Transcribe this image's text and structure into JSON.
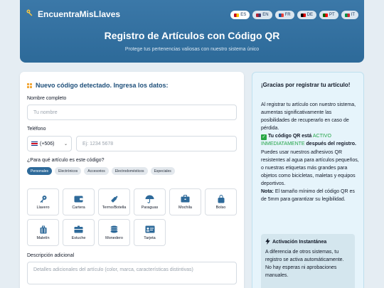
{
  "brand": {
    "name": "EncuentraMisLlaves",
    "icon": "key-icon"
  },
  "languages": [
    {
      "code": "ES",
      "flag_colors": [
        "#c60b1e",
        "#ffc400"
      ],
      "active": true
    },
    {
      "code": "EN",
      "flag_colors": [
        "#b22234",
        "#3c3b6e"
      ],
      "active": false
    },
    {
      "code": "FR",
      "flag_colors": [
        "#0055a4",
        "#ef4135"
      ],
      "active": false
    },
    {
      "code": "DE",
      "flag_colors": [
        "#000000",
        "#dd0000"
      ],
      "active": false
    },
    {
      "code": "PT",
      "flag_colors": [
        "#006600",
        "#ff0000"
      ],
      "active": false
    },
    {
      "code": "IT",
      "flag_colors": [
        "#009246",
        "#ce2b37"
      ],
      "active": false
    }
  ],
  "hero": {
    "title": "Registro de Artículos con Código QR",
    "subtitle": "Protege tus pertenencias valiosas con nuestro sistema único"
  },
  "form": {
    "heading": "Nuevo código detectado. Ingresa los datos:",
    "name_label": "Nombre completo",
    "name_placeholder": "Tu nombre",
    "phone_label": "Teléfono",
    "country_code": "(+506)",
    "phone_placeholder": "Ej: 1234 5678",
    "item_question": "¿Para qué artículo es este código?",
    "categories": [
      {
        "label": "Personales",
        "active": true
      },
      {
        "label": "Electrónicos",
        "active": false
      },
      {
        "label": "Accesorios",
        "active": false
      },
      {
        "label": "Electrodomésticos",
        "active": false
      },
      {
        "label": "Especiales",
        "active": false
      }
    ],
    "items": [
      {
        "label": "Llavero",
        "icon": "key-icon"
      },
      {
        "label": "Cartera",
        "icon": "wallet-icon"
      },
      {
        "label": "Termo/Botella",
        "icon": "bottle-icon"
      },
      {
        "label": "Paraguas",
        "icon": "umbrella-icon"
      },
      {
        "label": "Mochila",
        "icon": "briefcase-icon"
      },
      {
        "label": "Bolso",
        "icon": "bag-icon"
      },
      {
        "label": "Maletín",
        "icon": "suitcase-icon"
      },
      {
        "label": "Estuche",
        "icon": "case-icon"
      },
      {
        "label": "Monedero",
        "icon": "coins-icon"
      },
      {
        "label": "Tarjeta",
        "icon": "id-card-icon"
      }
    ],
    "desc_label": "Descripción adicional",
    "desc_placeholder": "Detalles adicionales del artículo (color, marca, características distintivas)"
  },
  "sidebar": {
    "title": "¡Gracias por registrar tu artículo!",
    "p1": "Al registrar tu artículo con nuestro sistema, aumentas significativamente las posibilidades de recuperarlo en caso de pérdida.",
    "qr_pre": "Tu código QR está",
    "qr_status": "ACTIVO INMEDIATAMENTE",
    "qr_post": "después del registro.",
    "p2": "Puedes usar nuestros adhesivos QR resistentes al agua para artículos pequeños, o nuestras etiquetas más grandes para objetos como bicicletas, maletas y equipos deportivos.",
    "note_label": "Nota:",
    "note_text": "El tamaño mínimo del código QR es de 5mm para garantizar su legibilidad.",
    "info_title": "Activación Instantánea",
    "info_text": "A diferencia de otros sistemas, tu registro se activa automáticamente. No hay esperas ni aprobaciones manuales."
  },
  "colors": {
    "accent": "#2e6a9a",
    "success": "#22a447",
    "header": "#3b78a8"
  }
}
